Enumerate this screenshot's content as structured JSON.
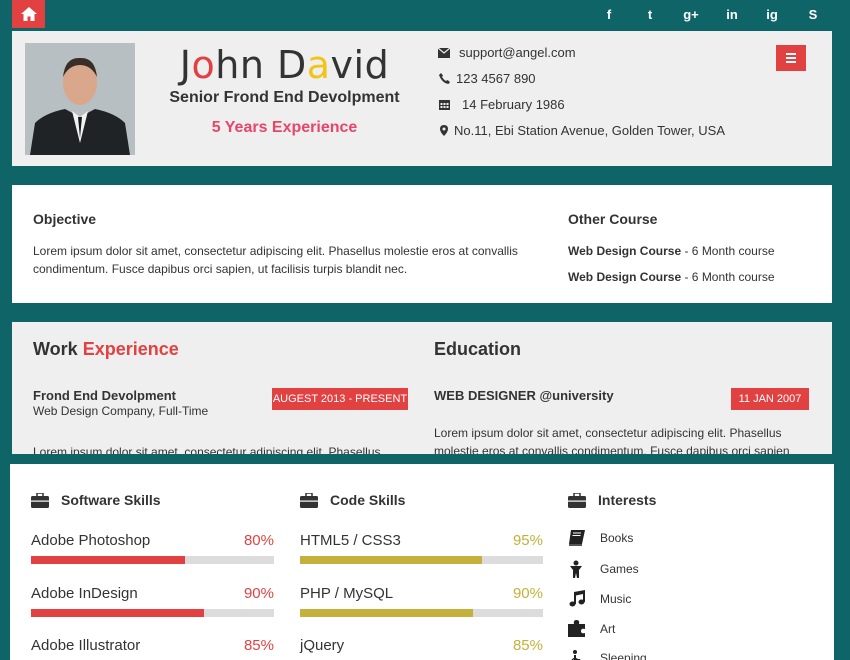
{
  "colors": {
    "accent": "#e24142",
    "gold": "#c4b03a",
    "teal": "#0f6468",
    "pink": "#e8456a"
  },
  "topbar": {
    "home_icon": "home-icon",
    "social": [
      "f",
      "t",
      "g+",
      "in",
      "ig",
      "S"
    ]
  },
  "header": {
    "name_part1": "J",
    "name_o": "o",
    "name_part2": "hn D",
    "name_a": "a",
    "name_part3": "vid",
    "role": "Senior Frond End Devolpment",
    "experience": "5 Years Experience",
    "email": "support@angel.com",
    "phone": "123 4567 890",
    "birthday": "14 February 1986",
    "address": "No.11, Ebi Station Avenue, Golden Tower, USA"
  },
  "objective": {
    "title": "Objective",
    "text": "Lorem ipsum dolor sit amet, consectetur adipiscing elit. Phasellus molestie eros at convallis condimentum. Fusce dapibus orci sapien, ut facilisis turpis blandit nec."
  },
  "other_course": {
    "title": "Other Course",
    "items": [
      {
        "name": "Web Design Course",
        "detail": " - 6 Month course"
      },
      {
        "name": "Web Design Course",
        "detail": " - 6 Month course"
      }
    ]
  },
  "work": {
    "title_a": "Work",
    "title_b": "Experience",
    "job_title": "Frond End Devolpment",
    "job_company": "Web Design Company, Full-Time",
    "job_date": "AUGEST 2013 - PRESENT",
    "job_text": "Lorem ipsum dolor sit amet, consectetur adipiscing elit. Phasellus"
  },
  "education": {
    "title": "Education",
    "degree": "WEB DESIGNER @university",
    "date": "11 JAN 2007",
    "text1": "Lorem ipsum dolor sit amet, consectetur adipiscing elit. Phasellus",
    "text2": "molestie eros at convallis condimentum. Fusce dapibus orci sapien"
  },
  "software_skills": {
    "title": "Software Skills",
    "items": [
      {
        "label": "Adobe Photoshop",
        "pct": "80%",
        "value": 80
      },
      {
        "label": "Adobe InDesign",
        "pct": "90%",
        "value": 90
      },
      {
        "label": "Adobe Illustrator",
        "pct": "85%",
        "value": 85
      }
    ]
  },
  "code_skills": {
    "title": "Code Skills",
    "items": [
      {
        "label": "HTML5 / CSS3",
        "pct": "95%",
        "value": 95
      },
      {
        "label": "PHP / MySQL",
        "pct": "90%",
        "value": 90
      },
      {
        "label": "jQuery",
        "pct": "85%",
        "value": 85
      }
    ]
  },
  "interests": {
    "title": "Interests",
    "items": [
      {
        "label": "Books",
        "icon": "book-icon"
      },
      {
        "label": "Games",
        "icon": "gamer-icon"
      },
      {
        "label": "Music",
        "icon": "music-icon"
      },
      {
        "label": "Art",
        "icon": "puzzle-icon"
      },
      {
        "label": "Sleeping",
        "icon": "wheelchair-icon"
      }
    ]
  }
}
